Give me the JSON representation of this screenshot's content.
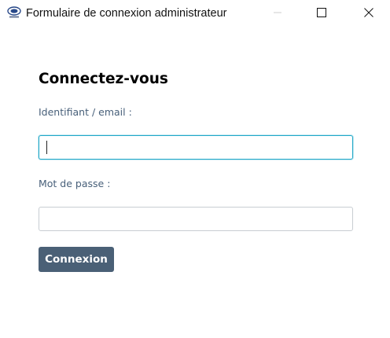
{
  "window": {
    "title": "Formulaire de connexion administrateur",
    "icon": "app-logo-icon",
    "controls": [
      "minimize-icon",
      "maximize-icon",
      "close-icon"
    ]
  },
  "form": {
    "heading": "Connectez-vous",
    "identifier_label": "Identifiant / email :",
    "identifier_value": "",
    "password_label": "Mot de passe :",
    "password_value": "",
    "submit_label": "Connexion"
  },
  "colors": {
    "label_text": "#48607a",
    "focus_border": "#20a8c8",
    "button_bg": "#4a6076",
    "button_text": "#ffffff"
  }
}
